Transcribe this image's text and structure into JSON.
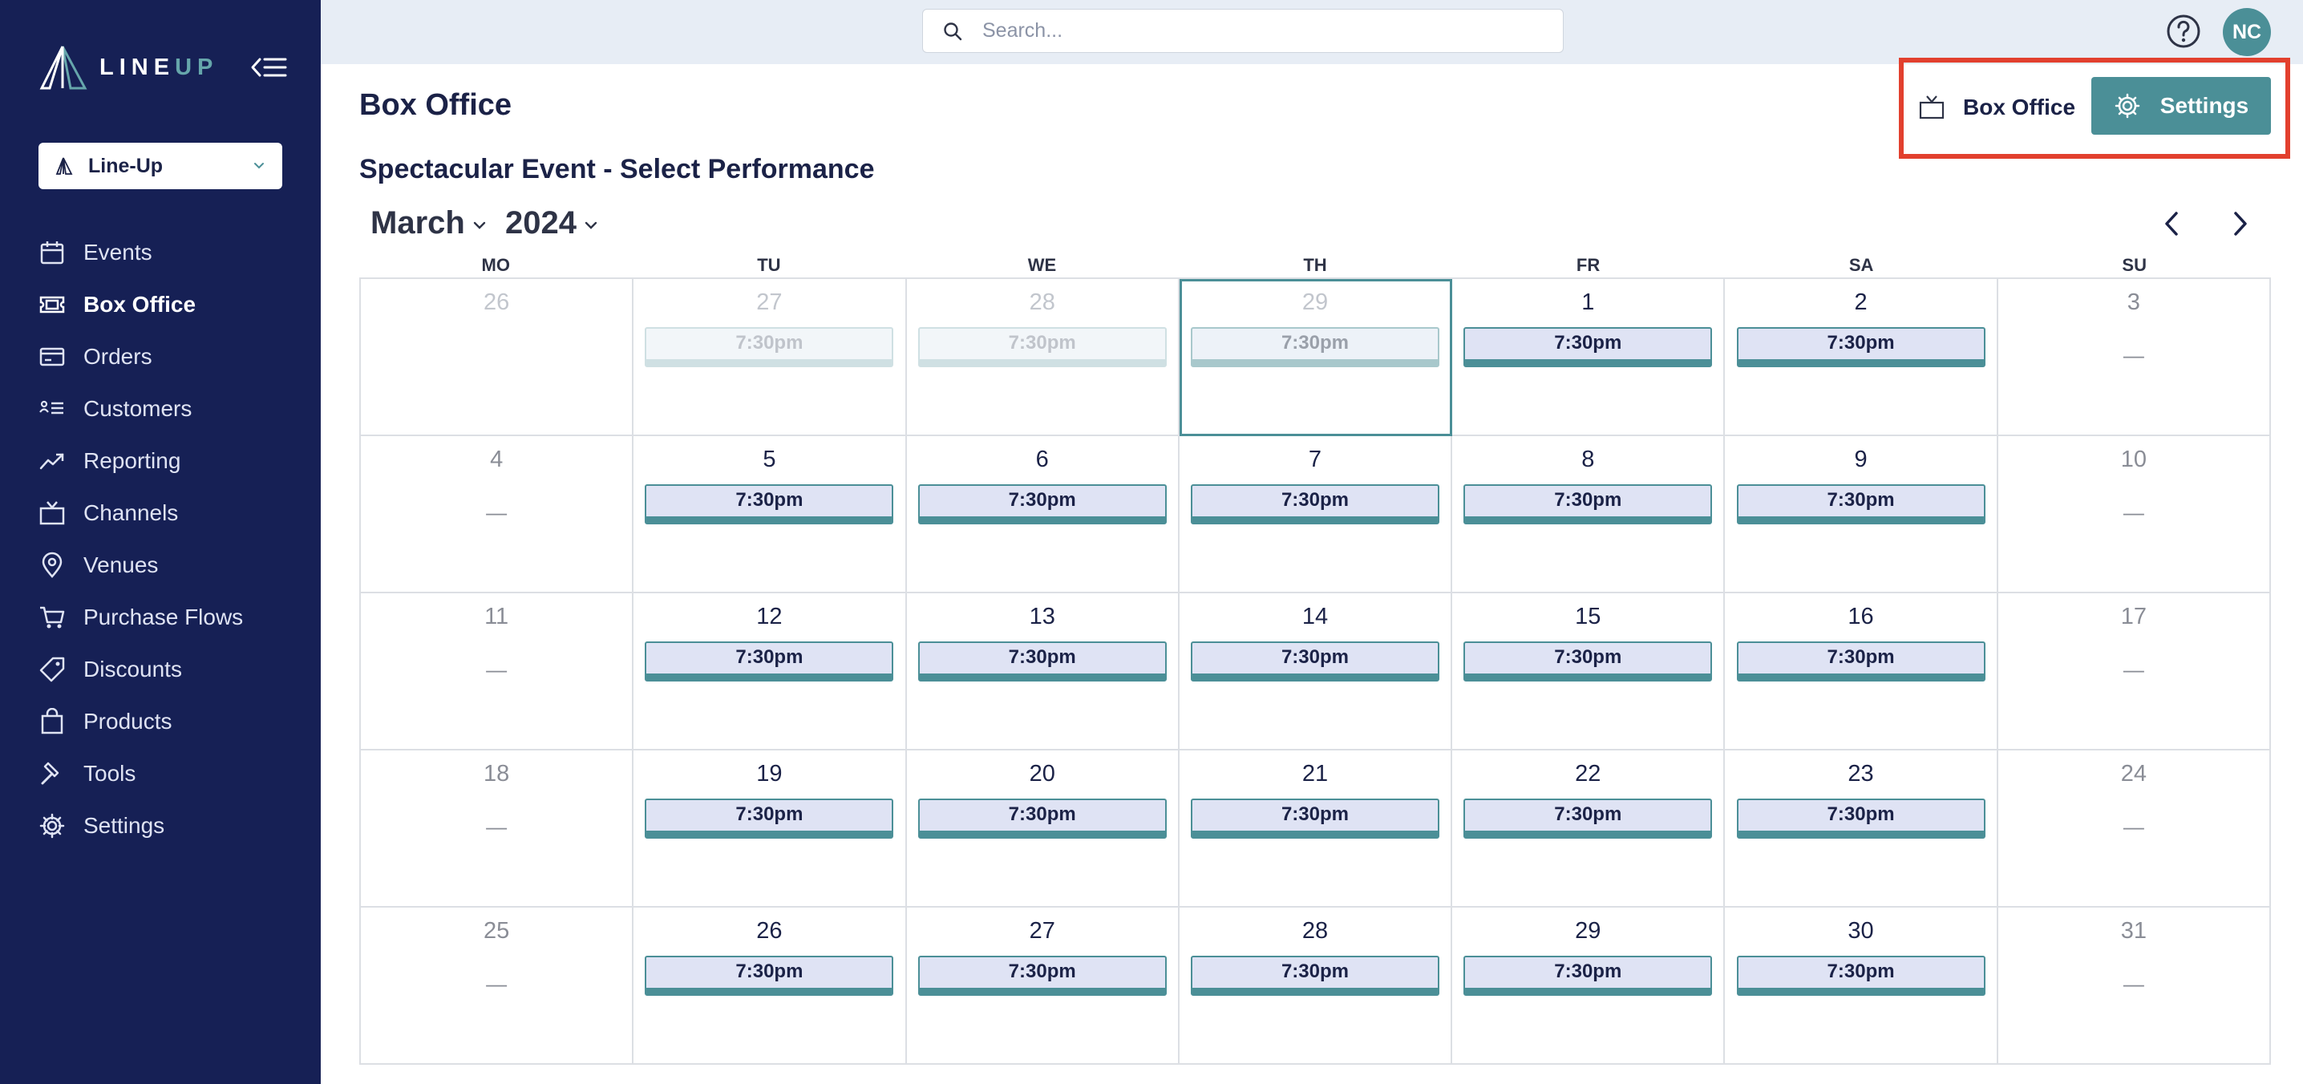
{
  "brand": {
    "logo_main": "LINE",
    "logo_accent": "UP"
  },
  "org_selector": {
    "label": "Line-Up"
  },
  "nav": {
    "items": [
      {
        "label": "Events",
        "icon": "calendar-icon"
      },
      {
        "label": "Box Office",
        "icon": "ticket-icon",
        "active": true
      },
      {
        "label": "Orders",
        "icon": "credit-card-icon"
      },
      {
        "label": "Customers",
        "icon": "contacts-list-icon"
      },
      {
        "label": "Reporting",
        "icon": "trend-chart-icon"
      },
      {
        "label": "Channels",
        "icon": "tv-icon"
      },
      {
        "label": "Venues",
        "icon": "map-pin-icon"
      },
      {
        "label": "Purchase Flows",
        "icon": "cart-icon"
      },
      {
        "label": "Discounts",
        "icon": "tag-icon"
      },
      {
        "label": "Products",
        "icon": "shopping-bag-icon"
      },
      {
        "label": "Tools",
        "icon": "hammer-icon"
      },
      {
        "label": "Settings",
        "icon": "gear-icon"
      }
    ]
  },
  "search": {
    "placeholder": "Search...",
    "value": ""
  },
  "user": {
    "initials": "NC"
  },
  "page": {
    "title": "Box Office",
    "subtitle": "Spectacular Event - Select Performance",
    "box_office_link": "Box Office",
    "settings_button": "Settings"
  },
  "calendar": {
    "month": "March",
    "year": "2024",
    "weekdays": [
      "MO",
      "TU",
      "WE",
      "TH",
      "FR",
      "SA",
      "SU"
    ],
    "weeks": [
      [
        {
          "day": "26",
          "outside": true,
          "weekend": false,
          "performance": null
        },
        {
          "day": "27",
          "outside": true,
          "weekend": false,
          "performance": "7:30pm"
        },
        {
          "day": "28",
          "outside": true,
          "weekend": false,
          "performance": "7:30pm"
        },
        {
          "day": "29",
          "outside": true,
          "weekend": false,
          "today": true,
          "performance": "7:30pm"
        },
        {
          "day": "1",
          "weekend": false,
          "performance": "7:30pm"
        },
        {
          "day": "2",
          "weekend": false,
          "performance": "7:30pm"
        },
        {
          "day": "3",
          "weekend": true,
          "performance": null,
          "empty": "—"
        }
      ],
      [
        {
          "day": "4",
          "weekend": true,
          "performance": null,
          "empty": "—"
        },
        {
          "day": "5",
          "performance": "7:30pm"
        },
        {
          "day": "6",
          "performance": "7:30pm"
        },
        {
          "day": "7",
          "performance": "7:30pm"
        },
        {
          "day": "8",
          "performance": "7:30pm"
        },
        {
          "day": "9",
          "performance": "7:30pm"
        },
        {
          "day": "10",
          "weekend": true,
          "performance": null,
          "empty": "—"
        }
      ],
      [
        {
          "day": "11",
          "weekend": true,
          "performance": null,
          "empty": "—"
        },
        {
          "day": "12",
          "performance": "7:30pm"
        },
        {
          "day": "13",
          "performance": "7:30pm"
        },
        {
          "day": "14",
          "performance": "7:30pm"
        },
        {
          "day": "15",
          "performance": "7:30pm"
        },
        {
          "day": "16",
          "performance": "7:30pm"
        },
        {
          "day": "17",
          "weekend": true,
          "performance": null,
          "empty": "—"
        }
      ],
      [
        {
          "day": "18",
          "weekend": true,
          "performance": null,
          "empty": "—"
        },
        {
          "day": "19",
          "performance": "7:30pm"
        },
        {
          "day": "20",
          "performance": "7:30pm"
        },
        {
          "day": "21",
          "performance": "7:30pm"
        },
        {
          "day": "22",
          "performance": "7:30pm"
        },
        {
          "day": "23",
          "performance": "7:30pm"
        },
        {
          "day": "24",
          "weekend": true,
          "performance": null,
          "empty": "—"
        }
      ],
      [
        {
          "day": "25",
          "weekend": true,
          "performance": null,
          "empty": "—"
        },
        {
          "day": "26",
          "performance": "7:30pm"
        },
        {
          "day": "27",
          "performance": "7:30pm"
        },
        {
          "day": "28",
          "performance": "7:30pm"
        },
        {
          "day": "29",
          "performance": "7:30pm"
        },
        {
          "day": "30",
          "performance": "7:30pm"
        },
        {
          "day": "31",
          "weekend": true,
          "performance": null,
          "empty": "—"
        }
      ]
    ]
  },
  "colors": {
    "sidebar_bg": "#162055",
    "accent_teal": "#4b8f97",
    "highlight_red": "#e2402e",
    "performance_bg": "#dfe3f4"
  }
}
